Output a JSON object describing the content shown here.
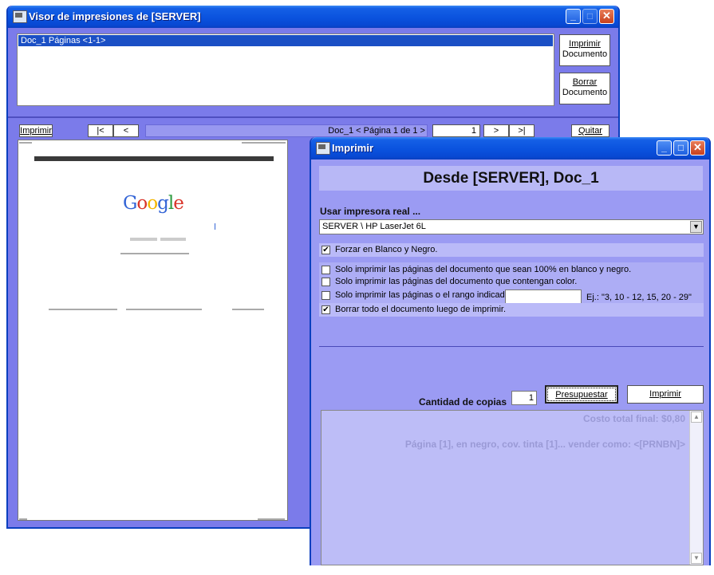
{
  "viewer": {
    "title": "Visor de impresiones de [SERVER]",
    "doc_list": [
      "Doc_1  Páginas <1-1>"
    ],
    "print_doc_line1": "Imprimir",
    "print_doc_line2": "Documento",
    "delete_doc_line1": "Borrar",
    "delete_doc_line2": "Documento",
    "toolbar": {
      "print": "Imprimir",
      "first": "|<",
      "prev": "<",
      "page_indicator": "Doc_1  < Página 1 de 1 >",
      "page_input": "1",
      "next": ">",
      "last": ">|",
      "quit": "Quitar"
    },
    "preview": {
      "logo": "Google"
    }
  },
  "dialog": {
    "title": "Imprimir",
    "header": "Desde [SERVER], Doc_1",
    "printer_label": "Usar impresora real ...",
    "printer_value": "SERVER \\ HP LaserJet 6L",
    "options": {
      "force_bw": {
        "label": "Forzar en Blanco y Negro.",
        "checked": true
      },
      "only_bw": {
        "label": "Solo imprimir las páginas del documento que sean 100% en blanco y negro.",
        "checked": false
      },
      "only_color": {
        "label": "Solo imprimir las páginas del documento que contengan color.",
        "checked": false
      },
      "only_range": {
        "label": "Solo imprimir las páginas o el rango indicado:",
        "checked": false
      },
      "delete_after": {
        "label": "Borrar todo el documento luego de imprimir.",
        "checked": true
      }
    },
    "range_hint": "Ej.: \"3, 10 - 12, 15, 20 - 29\"",
    "copies_label": "Cantidad de copias",
    "copies_value": "1",
    "budget_button": "Presupuestar",
    "print_button": "Imprimir",
    "result": {
      "cost": "Costo total final: $0,80",
      "detail": "Página [1], en negro, cov. tinta [1]... vender como: <[PRNBN]>"
    }
  },
  "colors": {
    "window_body": "#7b7bea",
    "dialog_body": "#9b9bf3",
    "titlebar": "#0a52de",
    "selection": "#1a4fc5"
  }
}
